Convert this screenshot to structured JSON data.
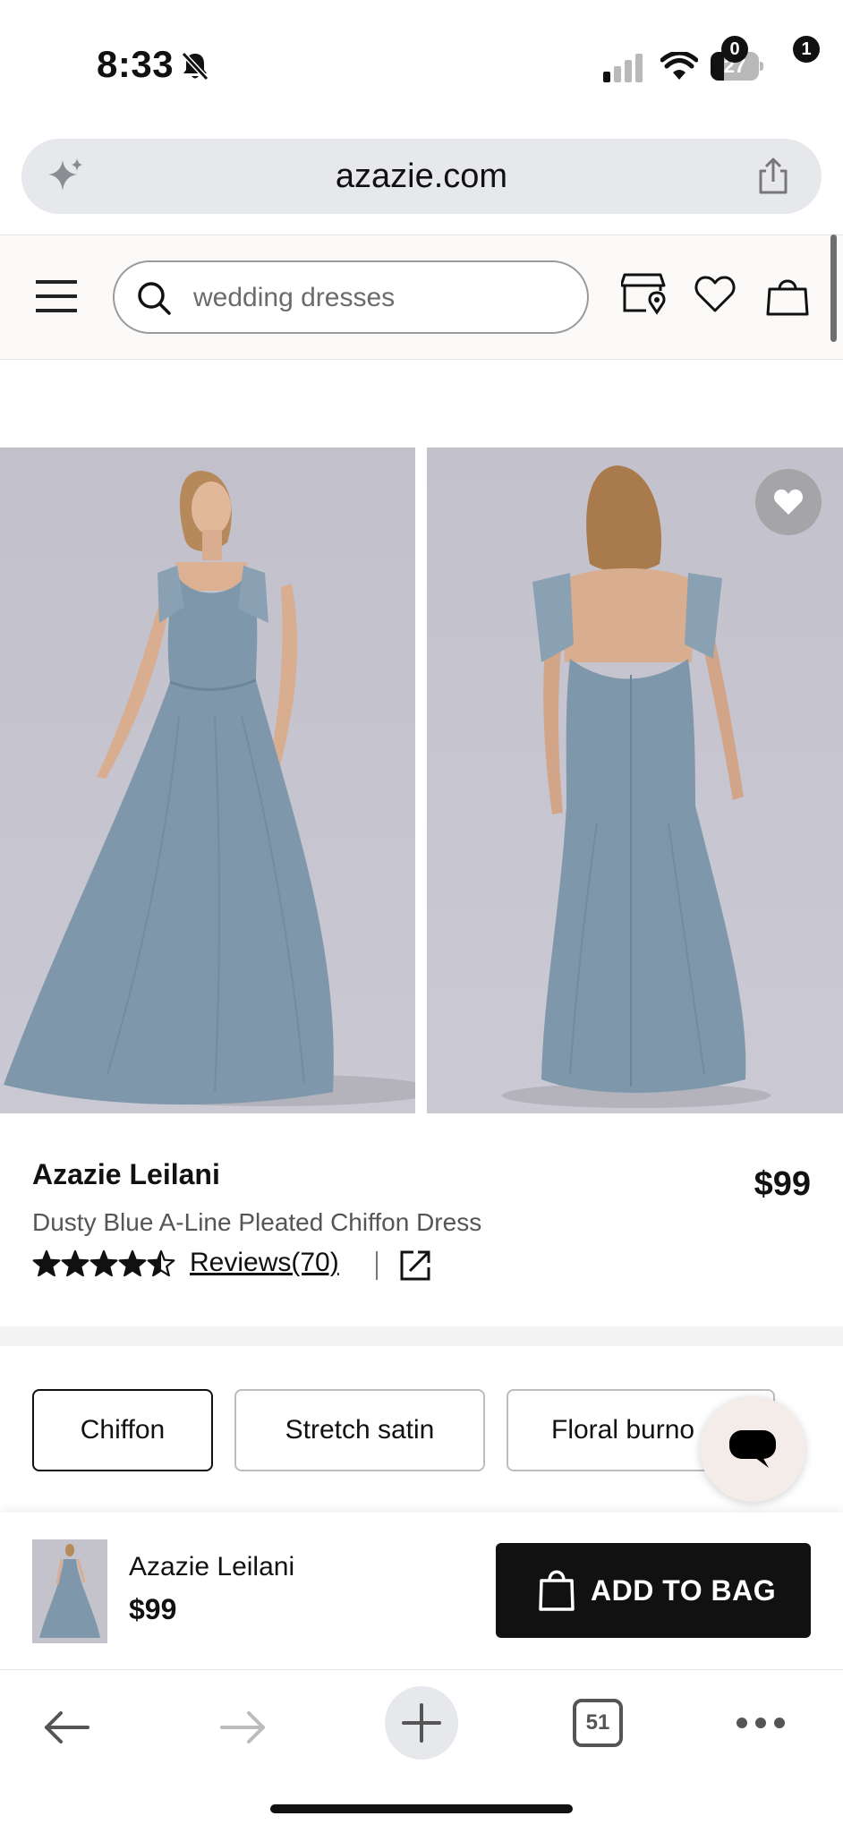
{
  "status_bar": {
    "time": "8:33",
    "battery_level": "27",
    "icons": [
      "bell-slash-icon",
      "signal-icon",
      "wifi-icon",
      "battery-icon"
    ]
  },
  "browser": {
    "url": "azazie.com",
    "tab_count": "51"
  },
  "header": {
    "search_placeholder": "wedding dresses",
    "wishlist_count": "0",
    "bag_count": "1",
    "icons": [
      "menu-icon",
      "search-icon",
      "store-locator-icon",
      "heart-icon",
      "shopping-bag-icon"
    ]
  },
  "product": {
    "name": "Azazie Leilani",
    "description": "Dusty Blue A-Line Pleated Chiffon Dress",
    "price": "$99",
    "rating": 4.5,
    "reviews_label": "Reviews(70)",
    "dress_color": "#7f97ab"
  },
  "fabric_options": [
    {
      "label": "Chiffon",
      "selected": true
    },
    {
      "label": "Stretch satin",
      "selected": false
    },
    {
      "label": "Floral burno",
      "selected": false
    }
  ],
  "sticky_bar": {
    "name": "Azazie Leilani",
    "price": "$99",
    "button_label": "ADD TO BAG"
  }
}
